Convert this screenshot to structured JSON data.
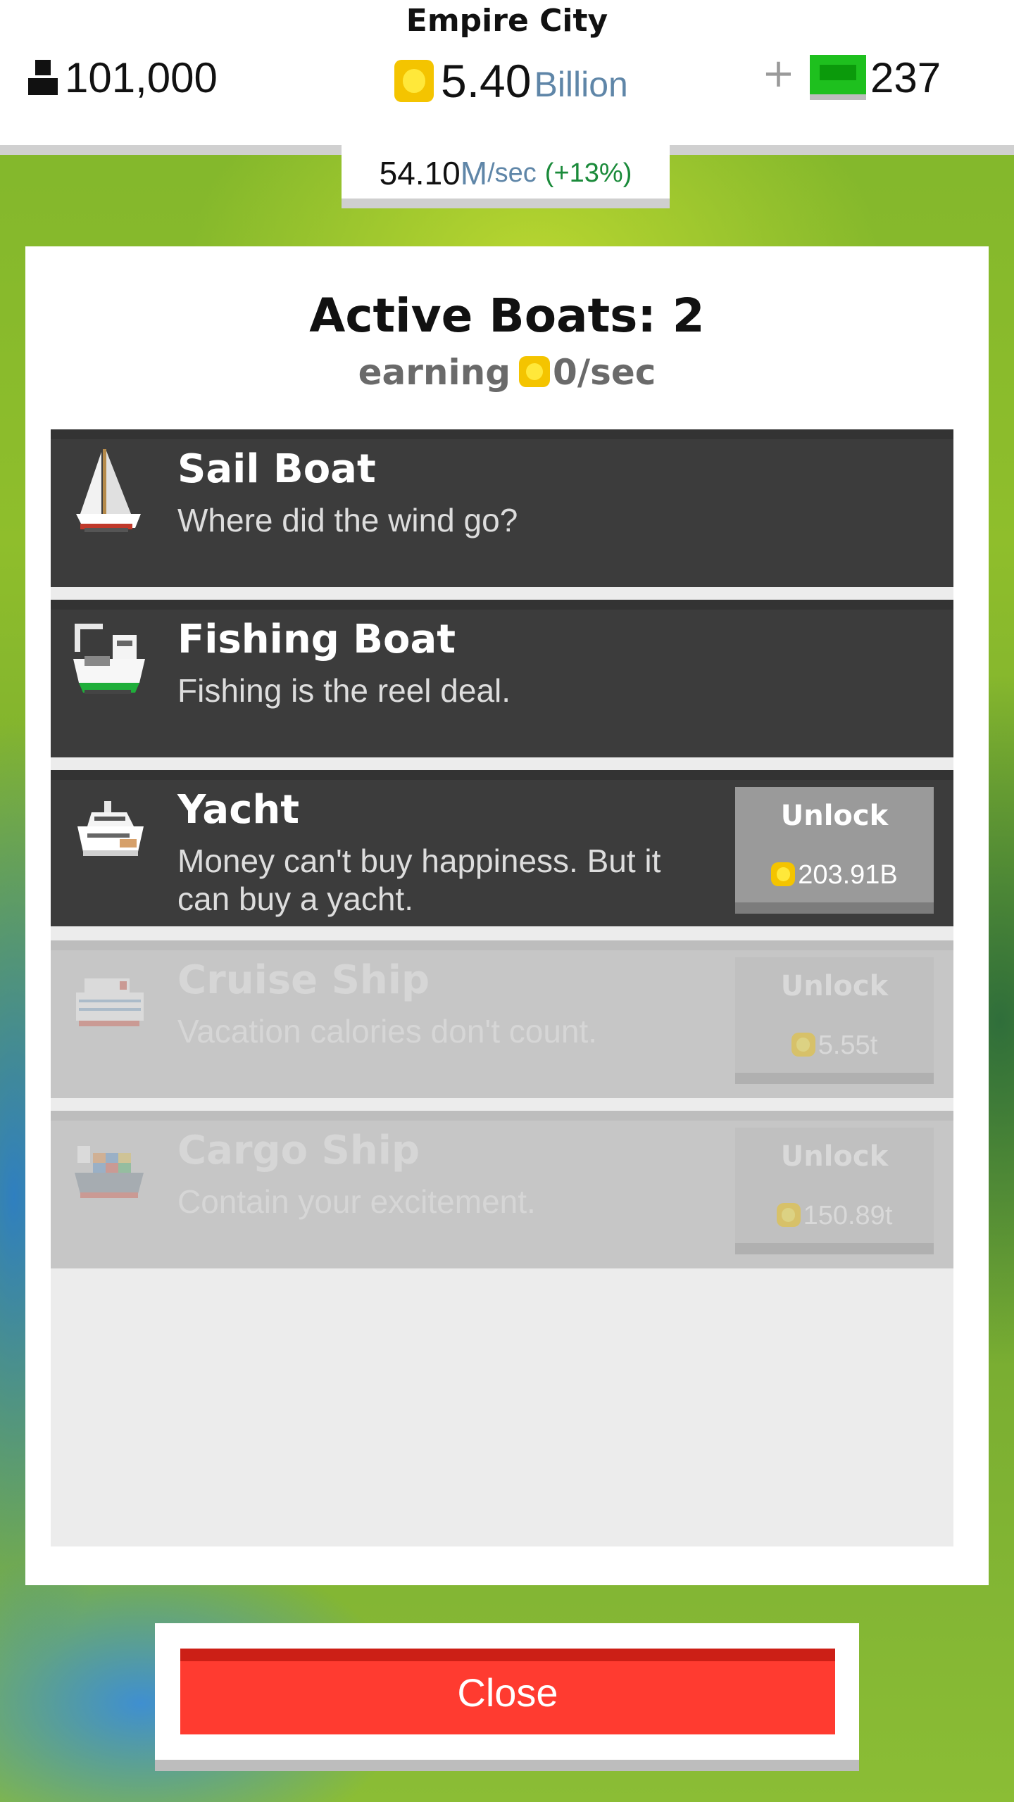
{
  "header": {
    "city_name": "Empire City",
    "population": "101,000",
    "money_value": "5.40",
    "money_unit": "Billion",
    "plus_label": "+",
    "gems": "237"
  },
  "rate": {
    "value": "54.10",
    "unit": "M",
    "per": "/sec",
    "bonus": "(+13%)"
  },
  "panel": {
    "title": "Active Boats: 2",
    "earning_label": "earning",
    "earning_value": "0/sec"
  },
  "boats": [
    {
      "name": "Sail Boat",
      "desc": "Where did the wind go?",
      "icon": "sailboat-icon"
    },
    {
      "name": "Fishing Boat",
      "desc": "Fishing is the reel deal.",
      "icon": "fishing-boat-icon"
    },
    {
      "name": "Yacht",
      "desc": "Money can't buy happiness. But it can buy a yacht.",
      "icon": "yacht-icon",
      "unlock_label": "Unlock",
      "price": "203.91B"
    },
    {
      "name": "Cruise Ship",
      "desc": "Vacation calories don't count.",
      "icon": "cruise-ship-icon",
      "unlock_label": "Unlock",
      "price": "5.55t"
    },
    {
      "name": "Cargo Ship",
      "desc": "Contain your excitement.",
      "icon": "cargo-ship-icon",
      "unlock_label": "Unlock",
      "price": "150.89t"
    }
  ],
  "close_label": "Close",
  "colors": {
    "accent_red": "#ff3b30",
    "row_dark": "#3c3c3c",
    "locked_grey": "#c6c6c6",
    "coin_gold": "#f4c400",
    "gem_green": "#1ec01e",
    "money_unit_blue": "#5f86a8",
    "bonus_green": "#1a8a3a"
  }
}
